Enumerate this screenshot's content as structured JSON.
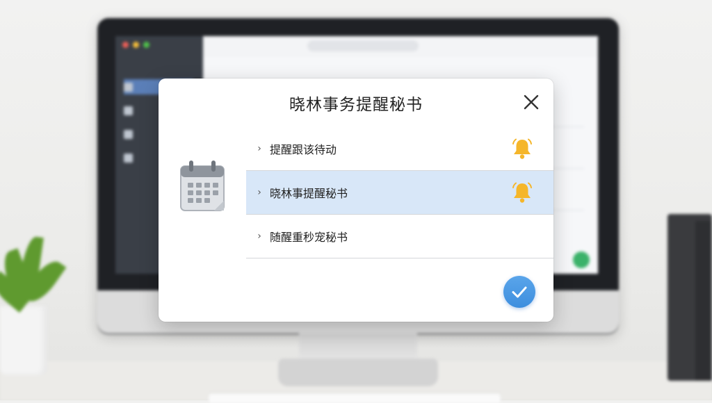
{
  "dialog": {
    "title": "晓林事务提醒秘书",
    "items": [
      {
        "label": "提醒跟该待动",
        "has_bell": true,
        "selected": false
      },
      {
        "label": "晓林事提醒秘书",
        "has_bell": true,
        "selected": true
      },
      {
        "label": "随醒重秒宠秘书",
        "has_bell": false,
        "selected": false
      }
    ],
    "icons": {
      "calendar": "calendar-icon",
      "bell": "bell-icon",
      "close": "close-icon",
      "confirm": "checkmark-icon"
    },
    "colors": {
      "selected_row": "#d8e7f8",
      "bell": "#f5b62a",
      "confirm_button": "#4a97e2"
    }
  }
}
